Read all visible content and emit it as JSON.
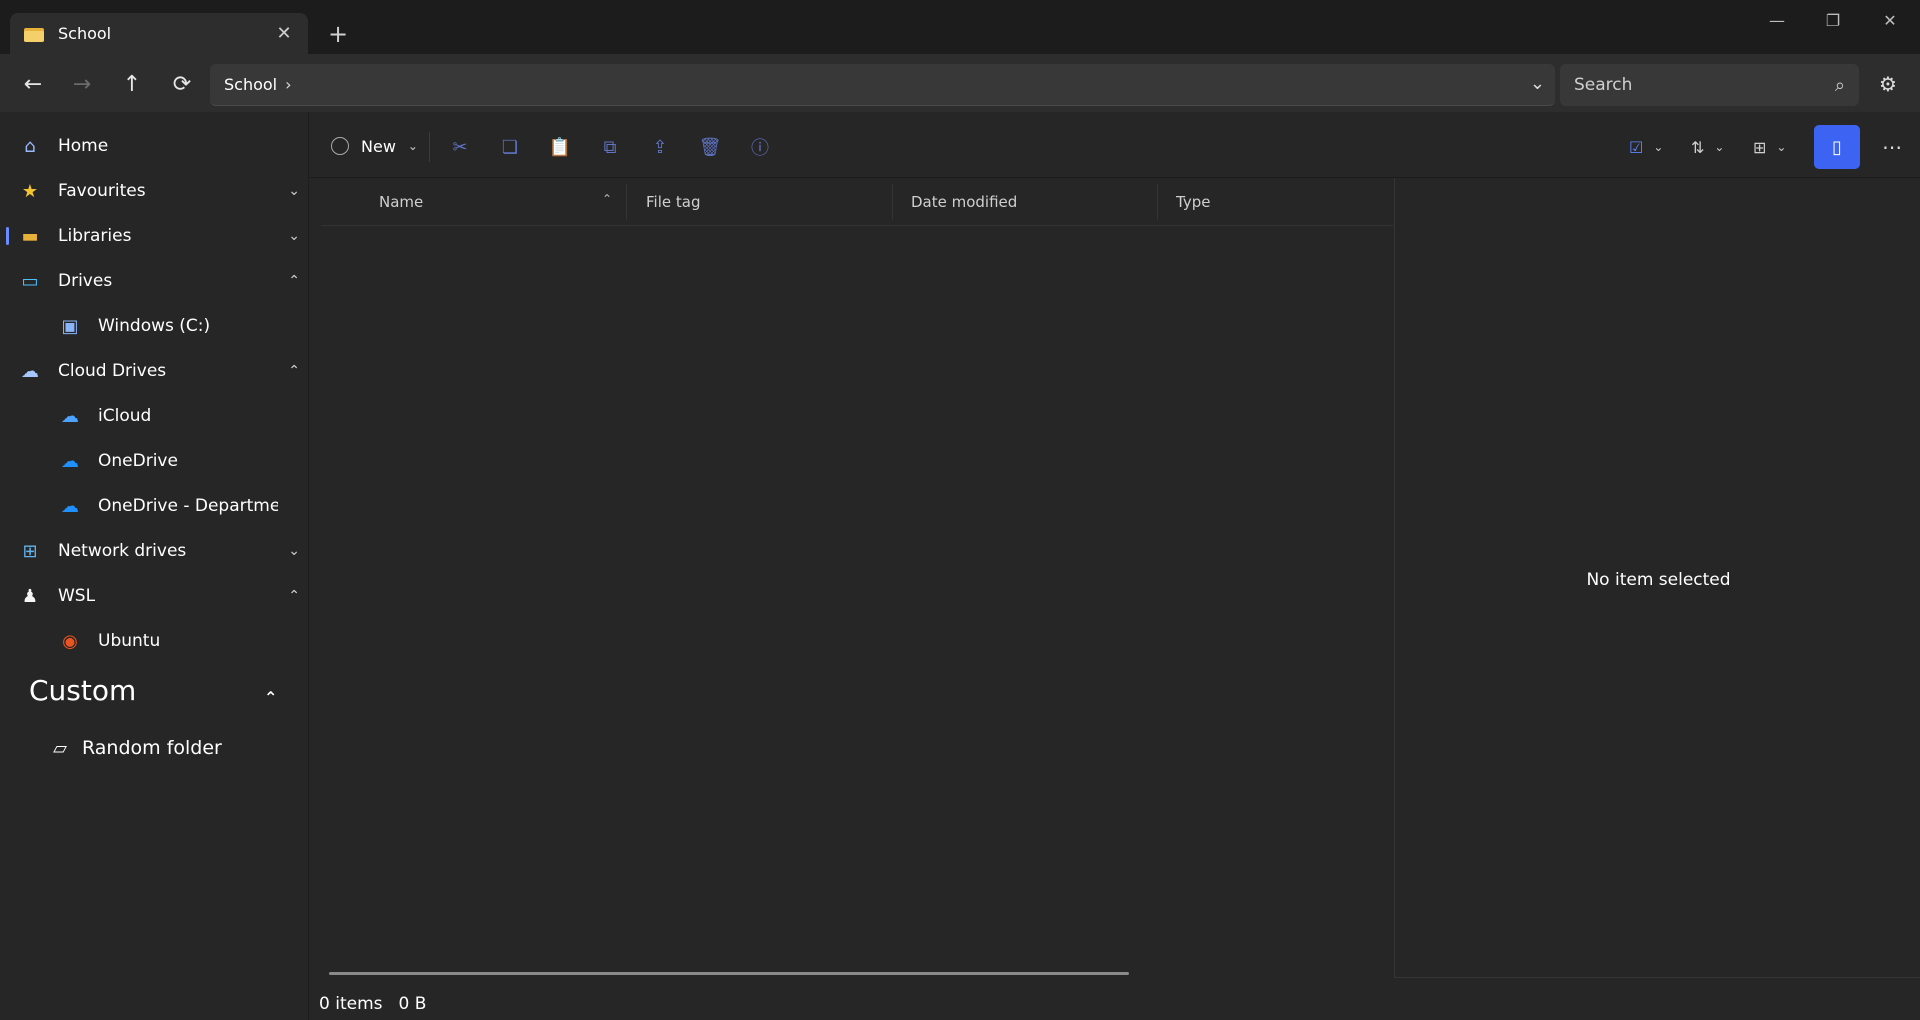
{
  "tab": {
    "title": "School",
    "close": "✕",
    "new": "+"
  },
  "window": {
    "minimize": "—",
    "restore": "❐",
    "close": "✕"
  },
  "nav": {
    "back": "←",
    "forward": "→",
    "up": "↑",
    "refresh": "⟳"
  },
  "address": {
    "crumb": "School",
    "separator": "›",
    "dropdown": "⌄"
  },
  "search": {
    "placeholder": "Search",
    "icon": "⌕"
  },
  "settings": {
    "icon": "⚙"
  },
  "sidebar": {
    "items": [
      {
        "label": "Home",
        "icon": "⌂",
        "color": "#9bb8ff"
      },
      {
        "label": "Favourites",
        "icon": "★",
        "color": "#f4c430",
        "chevron": "⌄"
      },
      {
        "label": "Libraries",
        "icon": "▬",
        "color": "#e8b23a",
        "chevron": "⌄"
      },
      {
        "label": "Drives",
        "icon": "▭",
        "color": "#4cc2ff",
        "chevron": "⌃"
      },
      {
        "label": "Windows (C:)",
        "icon": "▣",
        "color": "#8ab4f8"
      },
      {
        "label": "Cloud Drives",
        "icon": "☁",
        "color": "#a7c7ff",
        "chevron": "⌃"
      },
      {
        "label": "iCloud",
        "icon": "☁",
        "color": "#4da3ff"
      },
      {
        "label": "OneDrive",
        "icon": "☁",
        "color": "#1e90ff"
      },
      {
        "label": "OneDrive - Departmen",
        "icon": "☁",
        "color": "#1e90ff"
      },
      {
        "label": "Network drives",
        "icon": "⊞",
        "color": "#63b3ed",
        "chevron": "⌄"
      },
      {
        "label": "WSL",
        "icon": "♟",
        "color": "#f5f5f5",
        "chevron": "⌃"
      },
      {
        "label": "Ubuntu",
        "icon": "◉",
        "color": "#e95420"
      }
    ],
    "custom": {
      "title": "Custom",
      "chevron": "⌃",
      "items": [
        {
          "label": "Random folder",
          "icon": "▱"
        }
      ]
    }
  },
  "toolbar": {
    "new_label": "New",
    "new_chevron": "⌄",
    "icons": [
      "✂",
      "❏",
      "📋",
      "⧉",
      "⇪",
      "🗑",
      "ⓘ"
    ],
    "select_chevron": "⌄",
    "sort_icon": "⇅",
    "sort_chevron": "⌄",
    "layout_icon": "⊞",
    "layout_chevron": "⌄",
    "preview_icon": "▯",
    "more": "⋯",
    "accent": "#3d63f3"
  },
  "columns": {
    "name": "Name",
    "file_tag": "File tag",
    "date_modified": "Date modified",
    "type": "Type",
    "sort_arrow": "⌃"
  },
  "details": {
    "empty": "No item selected"
  },
  "status": {
    "items": "0 items",
    "size": "0 B"
  }
}
